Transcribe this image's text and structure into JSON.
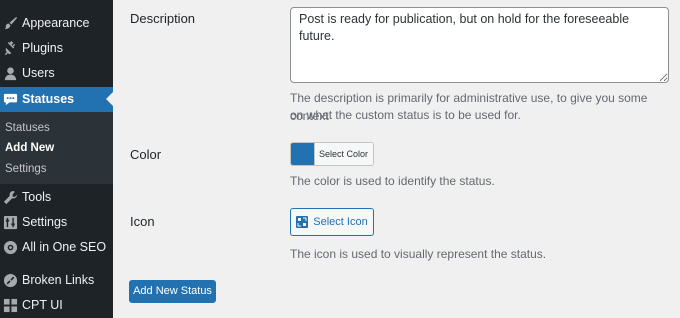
{
  "sidebar": {
    "items": [
      {
        "label": "Appearance",
        "icon": "paintbrush-icon"
      },
      {
        "label": "Plugins",
        "icon": "plug-icon"
      },
      {
        "label": "Users",
        "icon": "user-icon"
      },
      {
        "label": "Statuses",
        "icon": "speech-bubble-icon",
        "active": true
      },
      {
        "label": "Tools",
        "icon": "wrench-icon"
      },
      {
        "label": "Settings",
        "icon": "sliders-icon"
      },
      {
        "label": "All in One SEO",
        "icon": "aioseo-gear-icon"
      },
      {
        "label": "Broken Links",
        "icon": "broken-link-icon"
      },
      {
        "label": "CPT UI",
        "icon": "cpt-ui-icon"
      }
    ],
    "submenu": [
      {
        "label": "Statuses"
      },
      {
        "label": "Add New",
        "current": true
      },
      {
        "label": "Settings"
      }
    ]
  },
  "form": {
    "description": {
      "label": "Description",
      "value": "Post is ready for publication, but on hold for the foreseeable future.",
      "hint_line1": "The description is primarily for administrative use, to give you some context",
      "hint_line2": "on what the custom status is to be used for."
    },
    "color": {
      "label": "Color",
      "swatch": "#2271b1",
      "button_label": "Select Color",
      "hint": "The color is used to identify the status."
    },
    "icon": {
      "label": "Icon",
      "button_label": "Select Icon",
      "hint": "The icon is used to visually represent the status."
    },
    "submit_label": "Add New Status"
  },
  "colors": {
    "admin_menu_bg": "#1d2327",
    "submenu_bg": "#2c3338",
    "accent": "#2271b1",
    "page_bg": "#f0f0f1"
  }
}
